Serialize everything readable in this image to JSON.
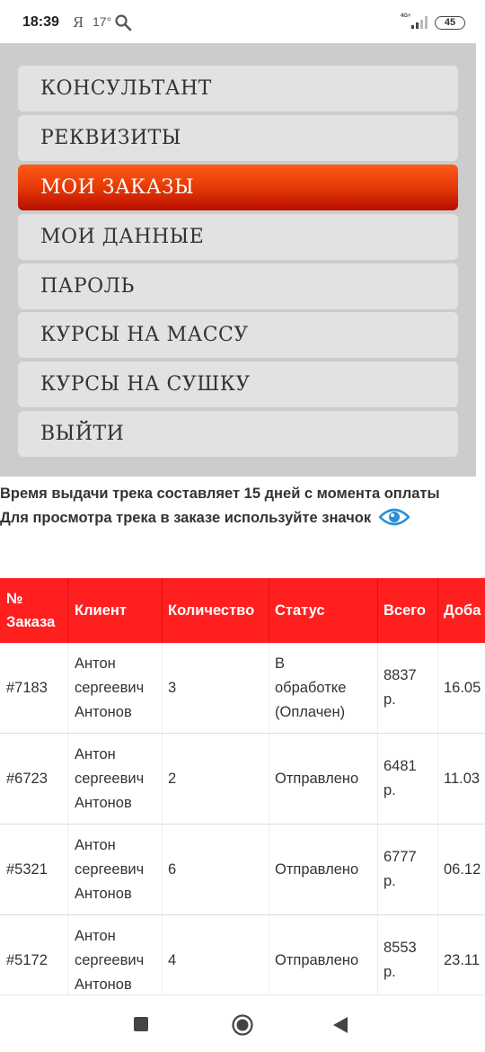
{
  "status_bar": {
    "time": "18:39",
    "app_letter": "Я",
    "temperature": "17°",
    "network": "4G+",
    "battery": "45"
  },
  "menu": {
    "items": [
      {
        "label": "КОНСУЛЬТАНТ",
        "active": false
      },
      {
        "label": "РЕКВИЗИТЫ",
        "active": false
      },
      {
        "label": "МОИ ЗАКАЗЫ",
        "active": true
      },
      {
        "label": "МОИ ДАННЫЕ",
        "active": false
      },
      {
        "label": "ПАРОЛЬ",
        "active": false
      },
      {
        "label": "КУРСЫ НА МАССУ",
        "active": false
      },
      {
        "label": "КУРСЫ НА СУШКУ",
        "active": false
      },
      {
        "label": "ВЫЙТИ",
        "active": false
      }
    ],
    "active_color": "#e63a06"
  },
  "info": {
    "line1": "Время выдачи трека составляет 15 дней с момента оплаты",
    "line2": "Для просмотра трека в заказе используйте значок"
  },
  "table": {
    "headers": {
      "number_line1": "№",
      "number_line2": "Заказа",
      "client": "Клиент",
      "quantity": "Количество",
      "status": "Статус",
      "total": "Всего",
      "added": "Доба"
    },
    "rows": [
      {
        "number": "#7183",
        "client_line1": "Антон",
        "client_line2": "сергеевич",
        "client_line3": "Антонов",
        "quantity": "3",
        "status_line1": "В",
        "status_line2": "обработке",
        "status_line3": "(Оплачен)",
        "total_line1": "8837",
        "total_line2": "р.",
        "added": "16.05"
      },
      {
        "number": "#6723",
        "client_line1": "Антон",
        "client_line2": "сергеевич",
        "client_line3": "Антонов",
        "quantity": "2",
        "status_line1": "Отправлено",
        "status_line2": "",
        "status_line3": "",
        "total_line1": "6481",
        "total_line2": "р.",
        "added": "11.03"
      },
      {
        "number": "#5321",
        "client_line1": "Антон",
        "client_line2": "сергеевич",
        "client_line3": "Антонов",
        "quantity": "6",
        "status_line1": "Отправлено",
        "status_line2": "",
        "status_line3": "",
        "total_line1": "6777",
        "total_line2": "р.",
        "added": "06.12"
      },
      {
        "number": "#5172",
        "client_line1": "Антон",
        "client_line2": "сергеевич",
        "client_line3": "Антонов",
        "quantity": "4",
        "status_line1": "Отправлено",
        "status_line2": "",
        "status_line3": "",
        "total_line1": "8553",
        "total_line2": "р.",
        "added": "23.11"
      }
    ],
    "header_color": "#ff1f1f"
  },
  "nav": {
    "recents_icon": "square-icon",
    "home_icon": "circle-icon",
    "back_icon": "triangle-back-icon"
  }
}
